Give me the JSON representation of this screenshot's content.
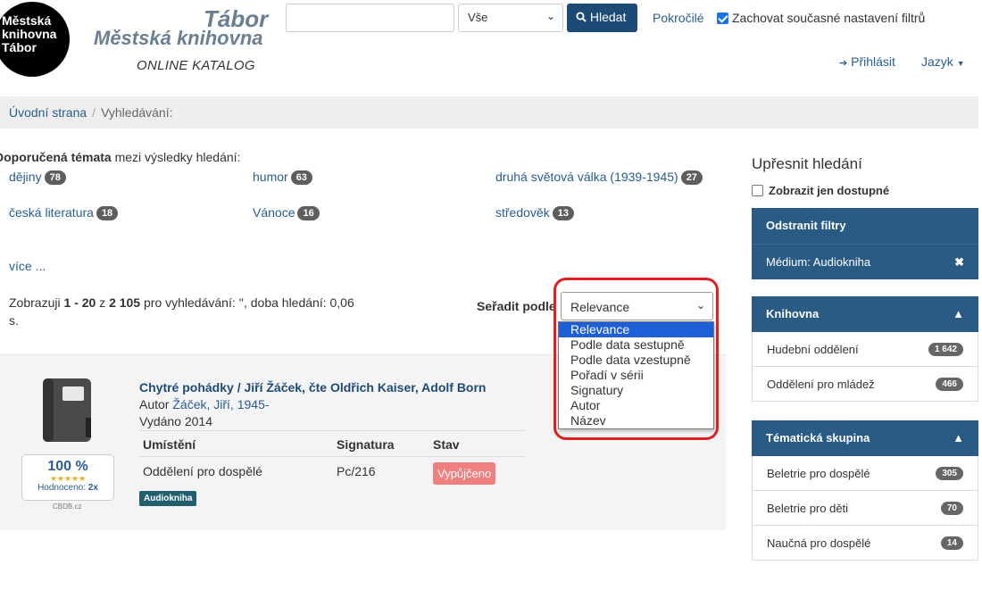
{
  "header": {
    "logo_lines": [
      "Městská",
      "knihovna",
      "Tábor"
    ],
    "logo_tabor": "Tábor",
    "logo_mk": "Městská knihovna",
    "logo_online": "ONLINE KATALOG",
    "search_value": "",
    "search_scope": "Vše",
    "search_button": "Hledat",
    "advanced": "Pokročilé",
    "keep_filters": "Zachovat současné nastavení filtrů",
    "login": "Přihlásit",
    "language": "Jazyk"
  },
  "breadcrumb": {
    "home": "Úvodní strana",
    "current": "Vyhledávání:"
  },
  "topics": {
    "heading_bold": "Doporučená témata",
    "heading_rest": " mezi výsledky hledání:",
    "items": [
      {
        "label": "dějiny",
        "count": "78"
      },
      {
        "label": "humor",
        "count": "63"
      },
      {
        "label": "druhá světová válka (1939-1945)",
        "count": "27"
      },
      {
        "label": "česká literatura",
        "count": "18"
      },
      {
        "label": "Vánoce",
        "count": "16"
      },
      {
        "label": "středověk",
        "count": "13"
      }
    ],
    "more": "více ..."
  },
  "results": {
    "pre": "Zobrazuji ",
    "range": "1 - 20",
    "mid": " z ",
    "total": "2 105",
    "post": " pro vyhledávání: '', doba hledání: 0,06 s.",
    "sort_label": "Seřadit podle",
    "sort_value": "Relevance",
    "sort_options": [
      "Relevance",
      "Podle data sestupně",
      "Podle data vzestupně",
      "Pořadí v sérii",
      "Signatury",
      "Autor",
      "Název"
    ]
  },
  "result": {
    "rating_pct": "100 %",
    "stars": "★★★★★",
    "rating_label": "Hodnoceno: ",
    "rating_count": "2x",
    "rating_source": "CBDB.cz",
    "title": "Chytré pohádky / Jiří Žáček, čte Oldřich Kaiser, Adolf Born",
    "author_label": "Autor ",
    "author": "Žáček, Jiří, 1945-",
    "year": "Vydáno 2014",
    "col_location": "Umístění",
    "col_signature": "Signatura",
    "col_status": "Stav",
    "location": "Oddělení pro dospělé",
    "signature": "Pc/216",
    "status": "Vypůjčeno",
    "format": "Audiokniha"
  },
  "sidebar": {
    "title": "Upřesnit hledání",
    "only_available": "Zobrazit jen dostupné",
    "remove_filters": "Odstranit filtry",
    "active_filter": "Médium: Audiokniha",
    "library_head": "Knihovna",
    "library_items": [
      {
        "label": "Hudební oddělení",
        "count": "1 642"
      },
      {
        "label": "Oddělení pro mládež",
        "count": "466"
      }
    ],
    "topic_head": "Tématická skupina",
    "topic_items": [
      {
        "label": "Beletrie pro dospělé",
        "count": "305"
      },
      {
        "label": "Beletrie pro děti",
        "count": "70"
      },
      {
        "label": "Naučná pro dospělé",
        "count": "14"
      }
    ]
  }
}
